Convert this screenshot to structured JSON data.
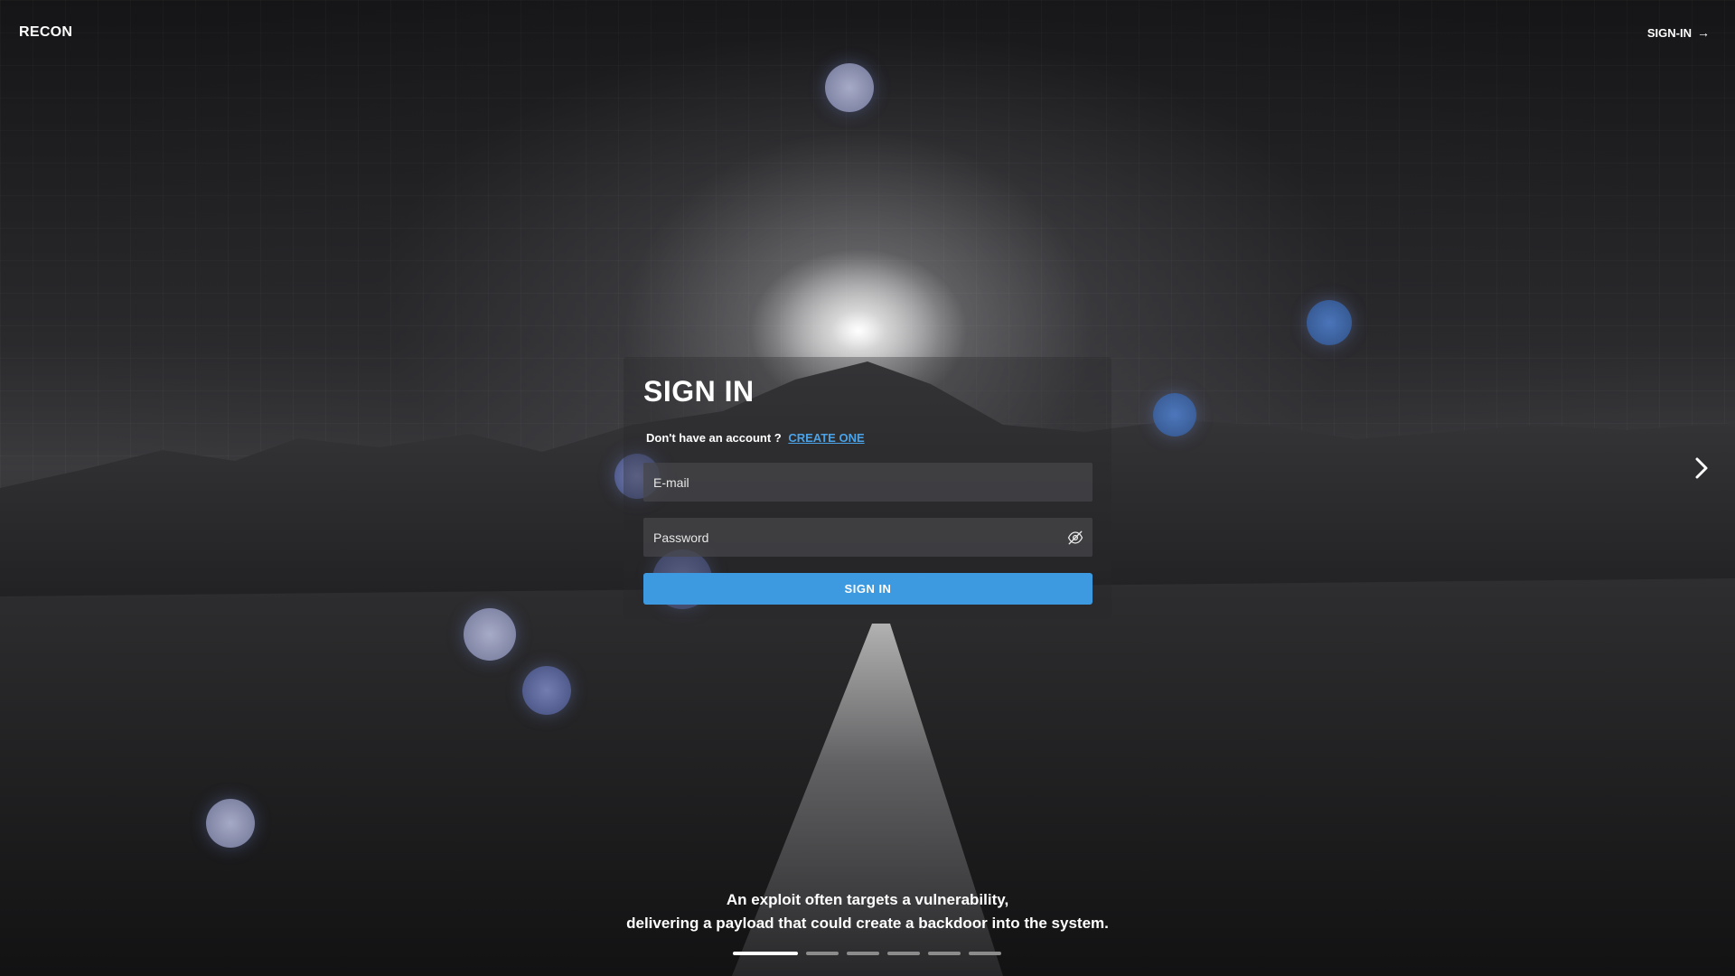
{
  "header": {
    "brand": "RECON",
    "signin_link": "SIGN-IN",
    "signin_arrow": "→"
  },
  "form": {
    "title": "SIGN IN",
    "account_prompt": "Don't have an account ?",
    "create_link": "CREATE ONE",
    "email_placeholder": "E-mail",
    "password_placeholder": "Password",
    "submit_label": "SIGN IN"
  },
  "carousel": {
    "caption_line1": "An exploit often targets a vulnerability,",
    "caption_line2": "delivering a payload that could create a backdoor into the system.",
    "slide_count": 6,
    "active_index": 0
  },
  "icons": {
    "password_toggle": "eye-off-icon",
    "next": "chevron-right-icon"
  },
  "colors": {
    "accent": "#3d9ae0",
    "link": "#4aa3e8"
  }
}
